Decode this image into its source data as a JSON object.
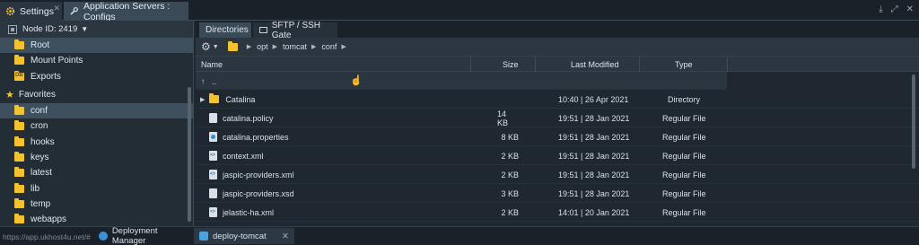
{
  "top_tabs": [
    {
      "label": "Settings",
      "icon": "gear-icon",
      "closable": true
    },
    {
      "label": "Application Servers : Configs",
      "icon": "wrench-icon",
      "closable": false
    }
  ],
  "window_controls": [
    "download-icon",
    "maximize-icon",
    "close-icon"
  ],
  "left_panel": {
    "node_label": "Node ID: 2419",
    "items": [
      {
        "label": "Root",
        "selected": true
      },
      {
        "label": "Mount Points",
        "selected": false
      },
      {
        "label": "Exports",
        "selected": false
      }
    ],
    "favorites_label": "Favorites",
    "favorites": [
      {
        "label": "conf",
        "selected": true
      },
      {
        "label": "cron"
      },
      {
        "label": "hooks"
      },
      {
        "label": "keys"
      },
      {
        "label": "latest"
      },
      {
        "label": "lib"
      },
      {
        "label": "temp"
      },
      {
        "label": "webapps"
      }
    ]
  },
  "right_panel": {
    "sub_tabs": [
      "Directories",
      "SFTP / SSH Gate"
    ],
    "path": [
      "opt",
      "tomcat",
      "conf"
    ],
    "columns": {
      "name": "Name",
      "size": "Size",
      "modified": "Last Modified",
      "type": "Type"
    },
    "up_row": "..",
    "rows": [
      {
        "name": "Catalina",
        "size": "",
        "modified": "10:40 | 26 Apr 2021",
        "type": "Directory",
        "kind": "folder"
      },
      {
        "name": "catalina.policy",
        "size": "14 KB",
        "modified": "19:51 | 28 Jan 2021",
        "type": "Regular File",
        "kind": "file"
      },
      {
        "name": "catalina.properties",
        "size": "8 KB",
        "modified": "19:51 | 28 Jan 2021",
        "type": "Regular File",
        "kind": "prop"
      },
      {
        "name": "context.xml",
        "size": "2 KB",
        "modified": "19:51 | 28 Jan 2021",
        "type": "Regular File",
        "kind": "xml"
      },
      {
        "name": "jaspic-providers.xml",
        "size": "2 KB",
        "modified": "19:51 | 28 Jan 2021",
        "type": "Regular File",
        "kind": "xml"
      },
      {
        "name": "jaspic-providers.xsd",
        "size": "3 KB",
        "modified": "19:51 | 28 Jan 2021",
        "type": "Regular File",
        "kind": "file"
      },
      {
        "name": "jelastic-ha.xml",
        "size": "2 KB",
        "modified": "14:01 | 20 Jan 2021",
        "type": "Regular File",
        "kind": "xml"
      }
    ]
  },
  "bottom_bar": {
    "url": "https://app.ukhost4u.net/#",
    "tabs": [
      {
        "label": "Deployment Manager",
        "closable": false
      },
      {
        "label": "deploy-tomcat",
        "closable": true
      }
    ]
  },
  "colors": {
    "background": "#1f2831",
    "selected": "#3e4f5e",
    "folder": "#f2c230"
  }
}
